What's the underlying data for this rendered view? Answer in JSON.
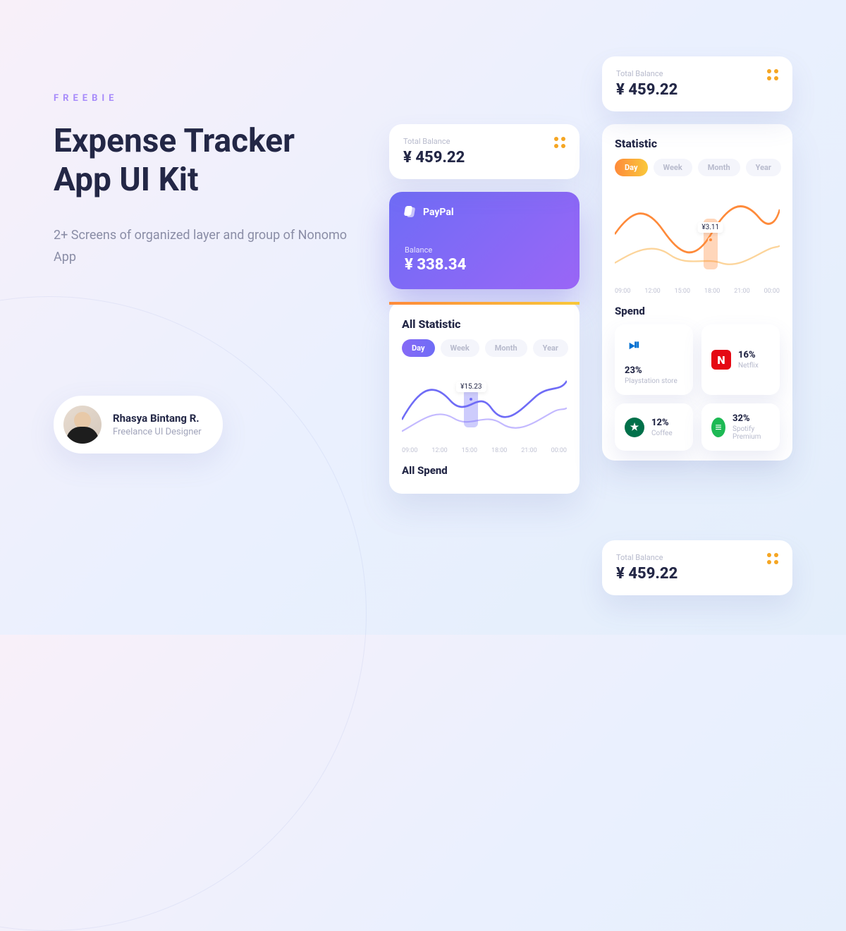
{
  "hero": {
    "eyebrow": "FREEBIE",
    "headline": "Expense Tracker App UI Kit",
    "sub": "2+ Screens of organized layer and group of Nonomo App"
  },
  "author": {
    "name": "Rhasya Bintang R.",
    "role": "Freelance UI Designer"
  },
  "balance_label": "Total Balance",
  "balance_value": "¥ 459.22",
  "paypal": {
    "name": "PayPal",
    "balance_label": "Balance",
    "balance": "¥ 338.34"
  },
  "section_all_statistic": "All Statistic",
  "section_statistic": "Statistic",
  "section_all_spend": "All Spend",
  "section_spend": "Spend",
  "tabs": {
    "day": "Day",
    "week": "Week",
    "month": "Month",
    "year": "Year"
  },
  "xaxis": [
    "09:00",
    "12:00",
    "15:00",
    "18:00",
    "21:00",
    "00:00"
  ],
  "marker_1": "¥15.23",
  "marker_2": "¥3.11",
  "spend": {
    "playstation": {
      "pct": "23%",
      "name": "Playstation store"
    },
    "netflix": {
      "pct": "16%",
      "name": "Netflix"
    },
    "coffee": {
      "pct": "12%",
      "name": "Coffee"
    },
    "spotify": {
      "pct": "32%",
      "name": "Spotify Premium"
    }
  },
  "colors": {
    "purple": "#6f6cf6",
    "orange": "#fe8a3a",
    "navy": "#232746",
    "netflix": "#e50914",
    "spotify": "#1db954",
    "ps": "#0070d1",
    "starbucks": "#00704a"
  },
  "chart_data": [
    {
      "type": "line",
      "title": "All Statistic",
      "x": [
        "09:00",
        "12:00",
        "15:00",
        "18:00",
        "21:00",
        "00:00"
      ],
      "series": [
        {
          "name": "spend-a",
          "values": [
            6,
            17,
            15.23,
            9,
            8,
            18
          ],
          "color": "#6f6cf6"
        },
        {
          "name": "spend-b",
          "values": [
            2,
            5,
            14,
            6,
            3,
            10
          ],
          "color": "#c3b9ff"
        }
      ],
      "highlight": {
        "x": "15:00",
        "value": 15.23,
        "label": "¥15.23"
      },
      "xlabel": "",
      "ylabel": "",
      "ylim": [
        0,
        20
      ]
    },
    {
      "type": "line",
      "title": "Statistic",
      "x": [
        "09:00",
        "12:00",
        "15:00",
        "18:00",
        "21:00",
        "00:00"
      ],
      "series": [
        {
          "name": "spend-a",
          "values": [
            4,
            10,
            6,
            3.11,
            5,
            11
          ],
          "color": "#fe8a3a"
        },
        {
          "name": "spend-b",
          "values": [
            2,
            4,
            8,
            3,
            2,
            6
          ],
          "color": "#fcd49a"
        }
      ],
      "highlight": {
        "x": "18:00",
        "value": 3.11,
        "label": "¥3.11"
      },
      "xlabel": "",
      "ylabel": "",
      "ylim": [
        0,
        12
      ]
    }
  ]
}
